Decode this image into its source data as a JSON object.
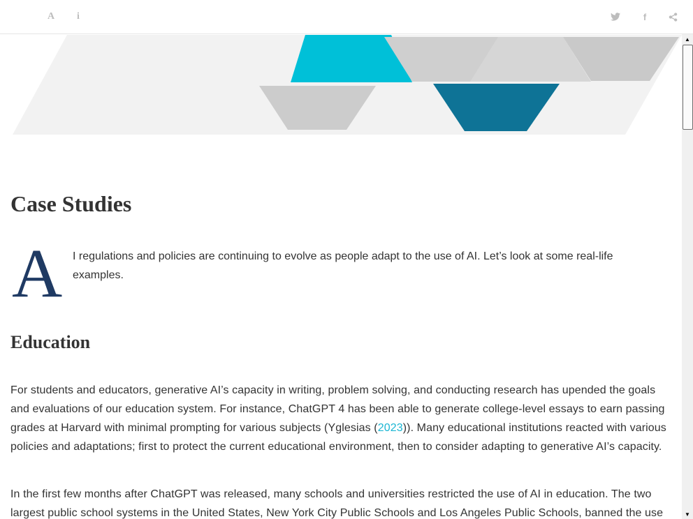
{
  "toolbar": {
    "font_icon": "A",
    "info_icon": "i"
  },
  "share": {
    "twitter_icon": "twitter-icon",
    "facebook_icon": "f",
    "share_icon": "share-icon"
  },
  "colors": {
    "accent": "#1bb6d3",
    "dropcap": "#1f3a63",
    "teal_light": "#00c0d8",
    "teal_dark": "#0e7396",
    "grey_shape": "#cccccc"
  },
  "article": {
    "heading": "Case Studies",
    "dropcap": "A",
    "intro": "I regulations and policies are continuing to evolve as people adapt to the use of AI. Let’s look at some real-life examples.",
    "section_heading": "Education",
    "p1_before": "For students and educators, generative AI’s capacity in writing, problem solving, and conducting research has upended the goals and evaluations of our education system. For instance, ChatGPT 4 has been able to generate college-level essays to earn passing grades at Harvard with minimal prompting for various subjects (Yglesias (",
    "p1_link": "2023",
    "p1_after": ")). Many educational institutions reacted with various policies and adaptations; first to protect the current educational environment, then to consider adapting to generative AI’s capacity.",
    "p2": "In the first few months after ChatGPT was released, many schools and universities restricted the use of AI in education. The two largest public school systems in the United States, New York City Public Schools and Los Angeles Public Schools, banned the use"
  }
}
